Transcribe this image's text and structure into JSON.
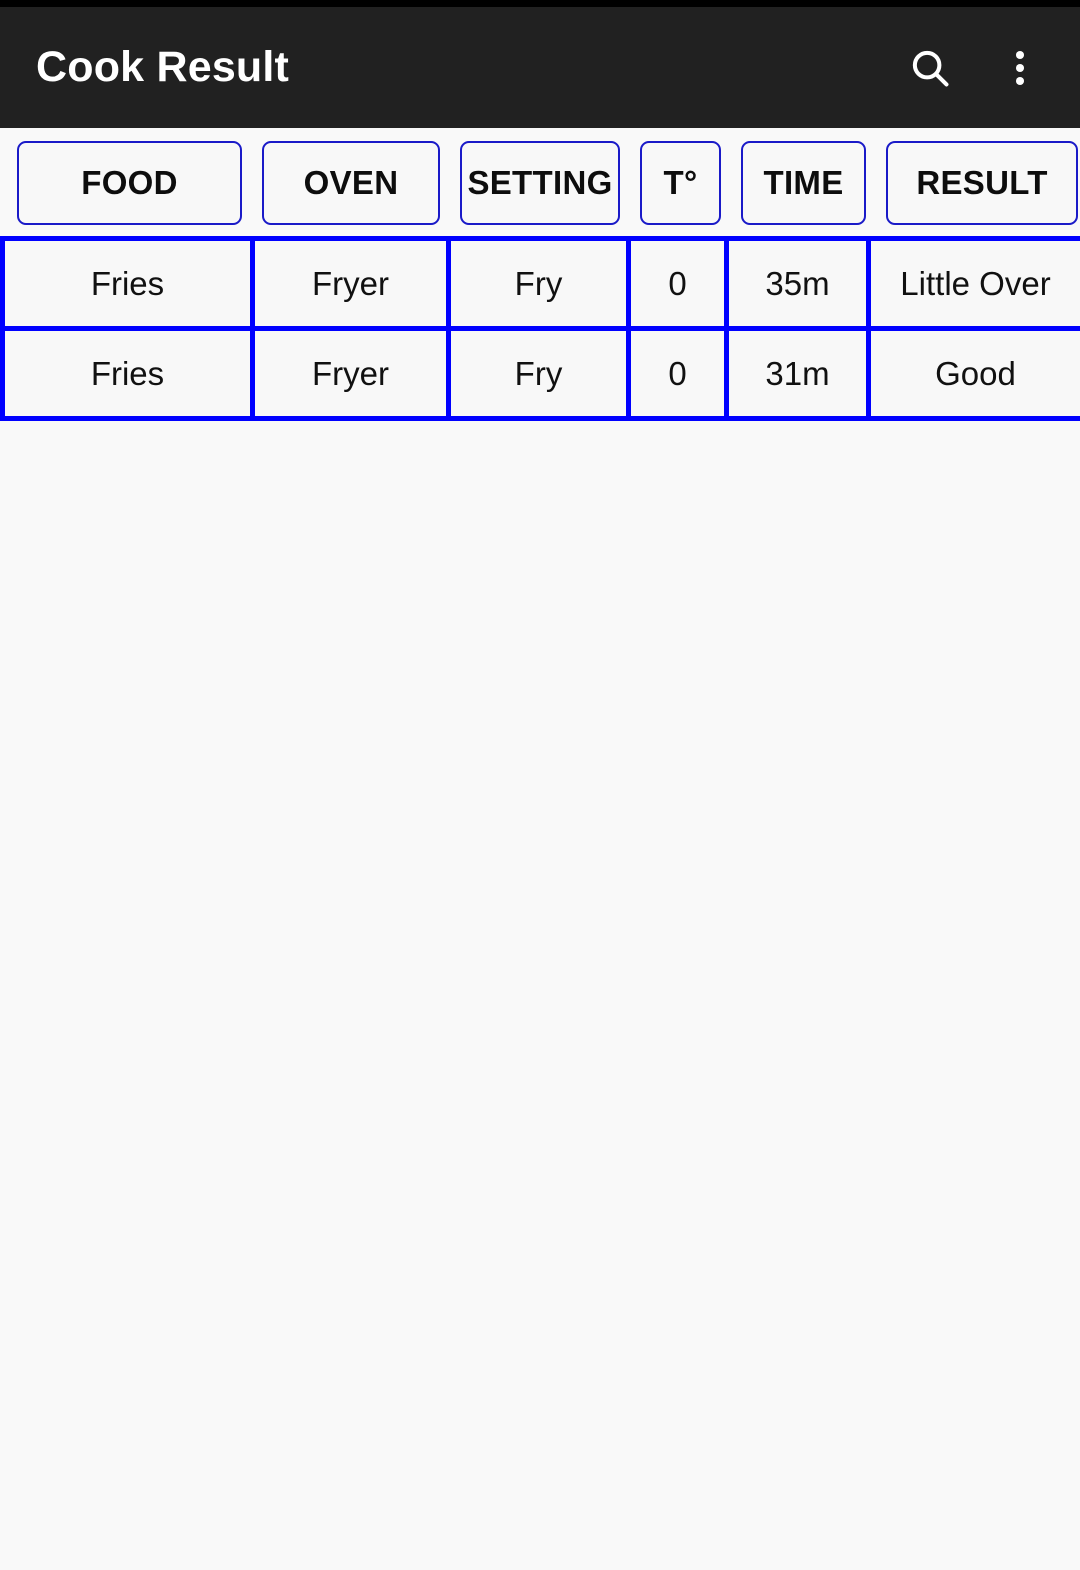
{
  "app": {
    "title": "Cook Result",
    "theme": {
      "appbar_bg": "#212121",
      "page_bg": "#f9f9f9",
      "cell_bg": "#f8f8f8",
      "data_border": "#0000ff",
      "header_border": "#1a1ac8",
      "title_color": "#ffffff",
      "text_color": "#111111"
    },
    "actions": [
      {
        "name": "search-icon",
        "label": "Search"
      },
      {
        "name": "overflow-menu-icon",
        "label": "More options"
      }
    ]
  },
  "table": {
    "headers": [
      {
        "key": "food",
        "label": "FOOD"
      },
      {
        "key": "oven",
        "label": "OVEN"
      },
      {
        "key": "setting",
        "label": "SETTING"
      },
      {
        "key": "temp",
        "label": "T°"
      },
      {
        "key": "time",
        "label": "TIME"
      },
      {
        "key": "result",
        "label": "RESULT"
      }
    ],
    "rows": [
      {
        "food": "Fries",
        "oven": "Fryer",
        "setting": "Fry",
        "temp": "0",
        "time": "35m",
        "result": "Little Over"
      },
      {
        "food": "Fries",
        "oven": "Fryer",
        "setting": "Fry",
        "temp": "0",
        "time": "31m",
        "result": "Good"
      }
    ]
  }
}
